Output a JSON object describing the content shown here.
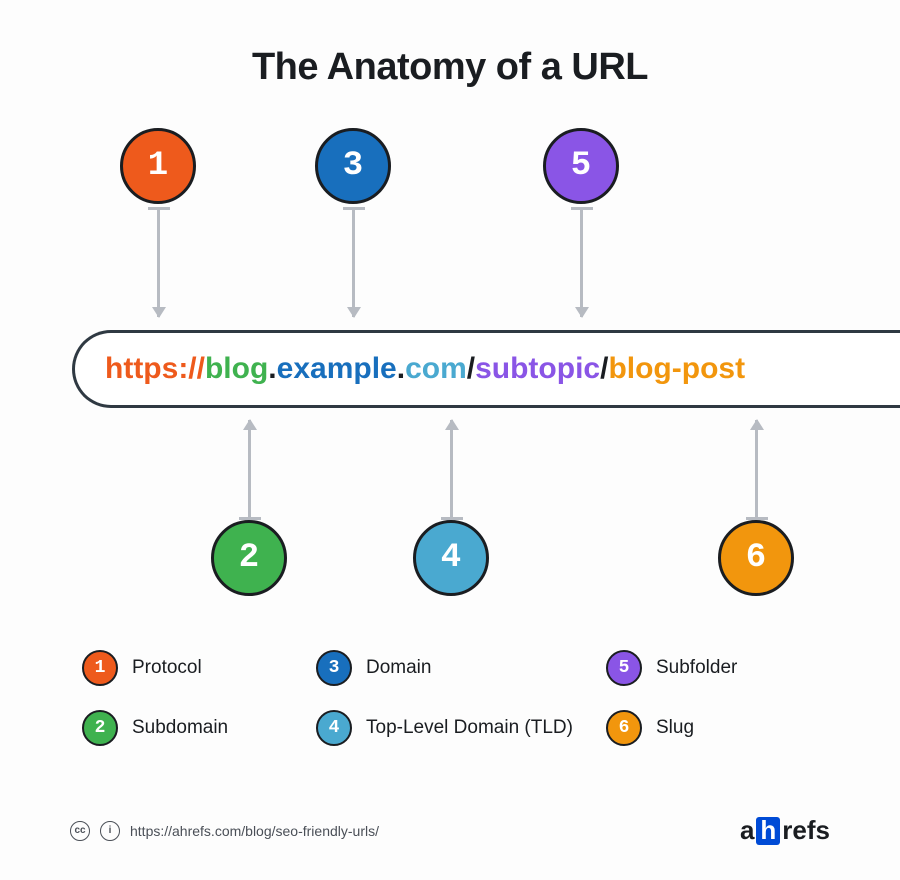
{
  "title": "The Anatomy of a URL",
  "url_parts": {
    "protocol": {
      "text": "https://",
      "color": "#ee5a1c"
    },
    "subdomain": {
      "text": "blog",
      "color": "#3fb24f"
    },
    "dot1": {
      "text": ".",
      "color": "#1a1d21"
    },
    "domain": {
      "text": "example",
      "color": "#186fbd"
    },
    "dot2": {
      "text": ".",
      "color": "#1a1d21"
    },
    "tld": {
      "text": "com",
      "color": "#4aa9d0"
    },
    "slash1": {
      "text": "/",
      "color": "#1a1d21"
    },
    "subfolder": {
      "text": "subtopic",
      "color": "#8a55e6"
    },
    "slash2": {
      "text": "/",
      "color": "#1a1d21"
    },
    "slug": {
      "text": "blog-post",
      "color": "#f2960d"
    }
  },
  "markers": {
    "m1": {
      "num": "1",
      "color": "#ee5a1c"
    },
    "m2": {
      "num": "2",
      "color": "#3fb24f"
    },
    "m3": {
      "num": "3",
      "color": "#186fbd"
    },
    "m4": {
      "num": "4",
      "color": "#4aa9d0"
    },
    "m5": {
      "num": "5",
      "color": "#8a55e6"
    },
    "m6": {
      "num": "6",
      "color": "#f2960d"
    }
  },
  "legend": {
    "l1": {
      "num": "1",
      "label": "Protocol"
    },
    "l2": {
      "num": "2",
      "label": "Subdomain"
    },
    "l3": {
      "num": "3",
      "label": "Domain"
    },
    "l4": {
      "num": "4",
      "label": "Top-Level Domain (TLD)"
    },
    "l5": {
      "num": "5",
      "label": "Subfolder"
    },
    "l6": {
      "num": "6",
      "label": "Slug"
    }
  },
  "footer": {
    "cc": "cc",
    "cc_by": "i",
    "source_url": "https://ahrefs.com/blog/seo-friendly-urls/",
    "brand_a": "a",
    "brand_h": "h",
    "brand_rest": "refs"
  }
}
